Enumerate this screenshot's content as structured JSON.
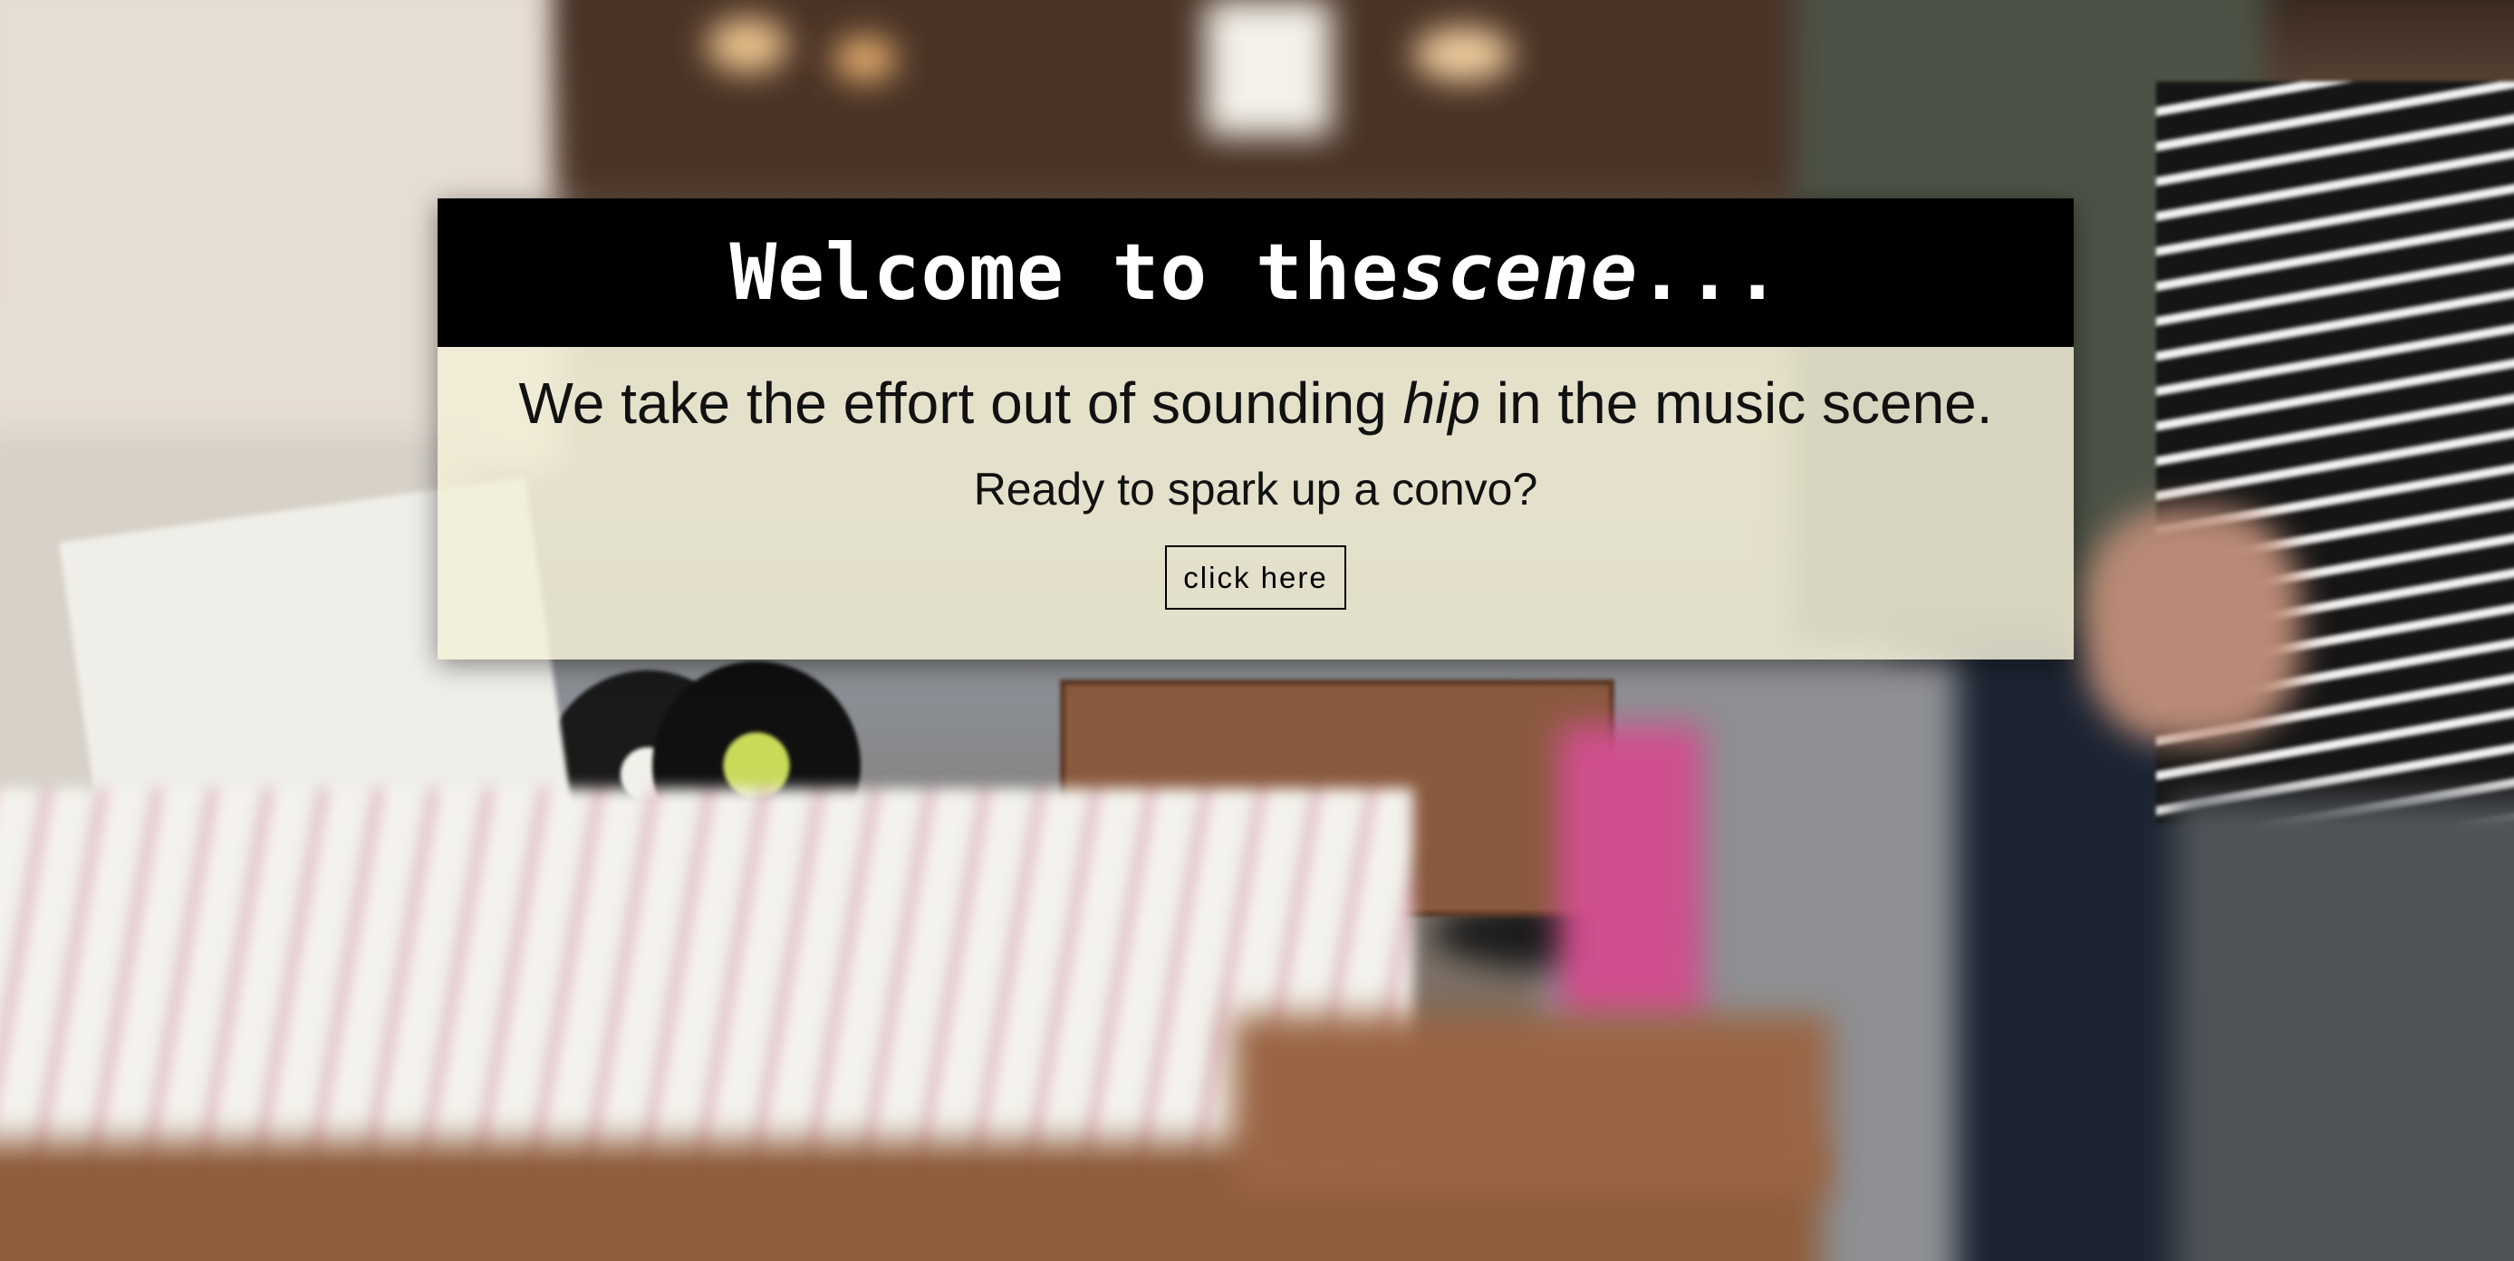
{
  "hero": {
    "title_prefix": "Welcome to the",
    "title_emphasis": "scene",
    "title_suffix": "...",
    "subtitle_before": "We take the effort out of sounding ",
    "subtitle_emphasis": "hip",
    "subtitle_after": " in the music scene.",
    "prompt": "Ready to spark up a convo?",
    "button_label": "click here"
  },
  "colors": {
    "title_bar_bg": "#000000",
    "title_text": "#ffffff",
    "body_panel_bg": "#f2eed6",
    "body_text": "#111111",
    "button_border": "#000000"
  }
}
